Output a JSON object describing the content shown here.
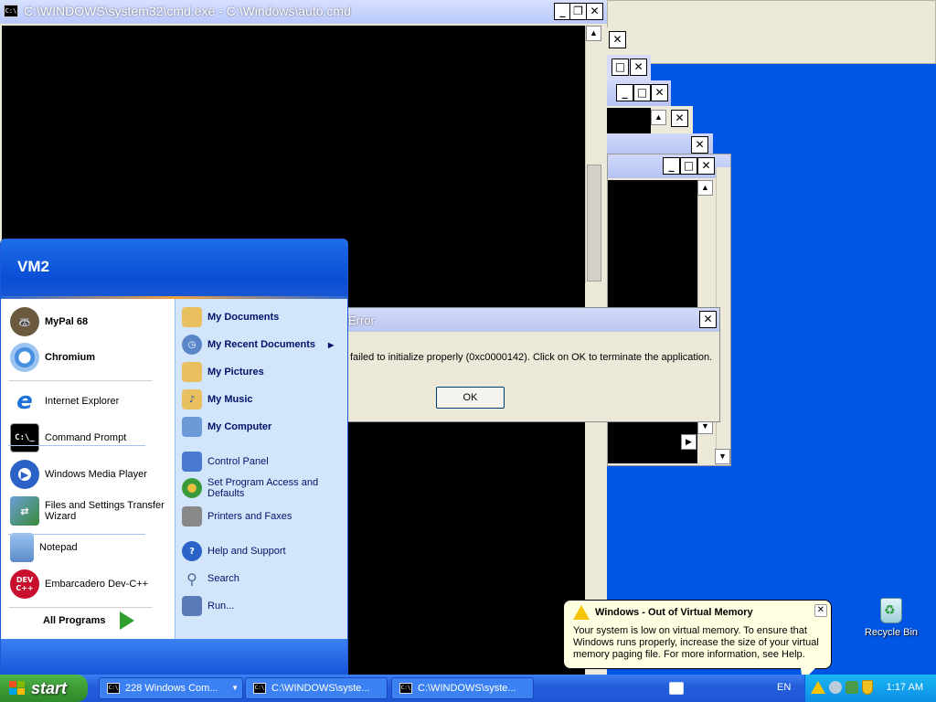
{
  "cmd_window": {
    "title": "C:\\WINDOWS\\system32\\cmd.exe - C:\\Windows\\auto.cmd",
    "icon_text": "C:\\",
    "minimize": "_",
    "restore": "❐",
    "close": "✕"
  },
  "stacked_windows": {
    "minimize": "_",
    "maximize": "□",
    "close": "✕"
  },
  "error_dialog": {
    "title": "Error",
    "message": "failed to initialize properly (0xc0000142). Click on OK to terminate the application.",
    "ok_label": "OK",
    "close": "✕"
  },
  "start_menu": {
    "user": "VM2",
    "left_items": [
      {
        "label": "MyPal 68",
        "icon": "raccoon-icon",
        "color": "#6b5a40"
      },
      {
        "label": "Chromium",
        "icon": "chromium-icon",
        "color": "#4a90e2"
      },
      {
        "label": "Internet Explorer",
        "icon": "ie-icon",
        "color": "#1e73d8"
      },
      {
        "label": "Command Prompt",
        "icon": "cmd-icon",
        "color": "#000000"
      },
      {
        "label": "Windows Media Player",
        "icon": "media-player-icon",
        "color": "#2c62c8"
      },
      {
        "label": "Files and Settings Transfer Wizard",
        "icon": "transfer-icon",
        "color": "#3a8a3a"
      },
      {
        "label": "Notepad",
        "icon": "notepad-icon",
        "color": "#6aa0d8"
      },
      {
        "label": "Embarcadero Dev-C++",
        "icon": "devcpp-icon",
        "color": "#c8102e"
      }
    ],
    "all_programs": "All Programs",
    "right_items": [
      {
        "label": "My Documents",
        "icon": "folder-icon",
        "color": "#e8c060"
      },
      {
        "label": "My Recent Documents",
        "icon": "recent-docs-icon",
        "color": "#5a86c8"
      },
      {
        "label": "My Pictures",
        "icon": "pictures-folder-icon",
        "color": "#e8c060"
      },
      {
        "label": "My Music",
        "icon": "music-folder-icon",
        "color": "#e8c060"
      },
      {
        "label": "My Computer",
        "icon": "computer-icon",
        "color": "#6a9ad8"
      },
      {
        "label": "Control Panel",
        "icon": "control-panel-icon",
        "color": "#4a7ad0"
      },
      {
        "label": "Set Program Access and Defaults",
        "icon": "program-access-icon",
        "color": "#3a9a3a"
      },
      {
        "label": "Printers and Faxes",
        "icon": "printer-icon",
        "color": "#888888"
      },
      {
        "label": "Help and Support",
        "icon": "help-icon",
        "color": "#2a62c8"
      },
      {
        "label": "Search",
        "icon": "search-icon",
        "color": "#6a8ab8"
      },
      {
        "label": "Run...",
        "icon": "run-icon",
        "color": "#5a7ab8"
      }
    ]
  },
  "taskbar": {
    "start_label": "start",
    "buttons": [
      {
        "label": "228 Windows Com...",
        "count": "228"
      },
      {
        "label": "C:\\WINDOWS\\syste..."
      },
      {
        "label": "C:\\WINDOWS\\syste..."
      }
    ],
    "language": "EN",
    "clock": "1:17 AM"
  },
  "balloon": {
    "title": "Windows - Out of Virtual Memory",
    "text": "Your system is low on virtual memory. To ensure that Windows runs properly, increase the size of your virtual memory paging file. For more information, see Help.",
    "close": "✕"
  },
  "desktop": {
    "recycle_bin": "Recycle Bin"
  },
  "colors": {
    "desktop": "#0055e5",
    "taskbar": "#245edb",
    "start_button": "#3c9b34",
    "tray": "#0f8ee6"
  }
}
